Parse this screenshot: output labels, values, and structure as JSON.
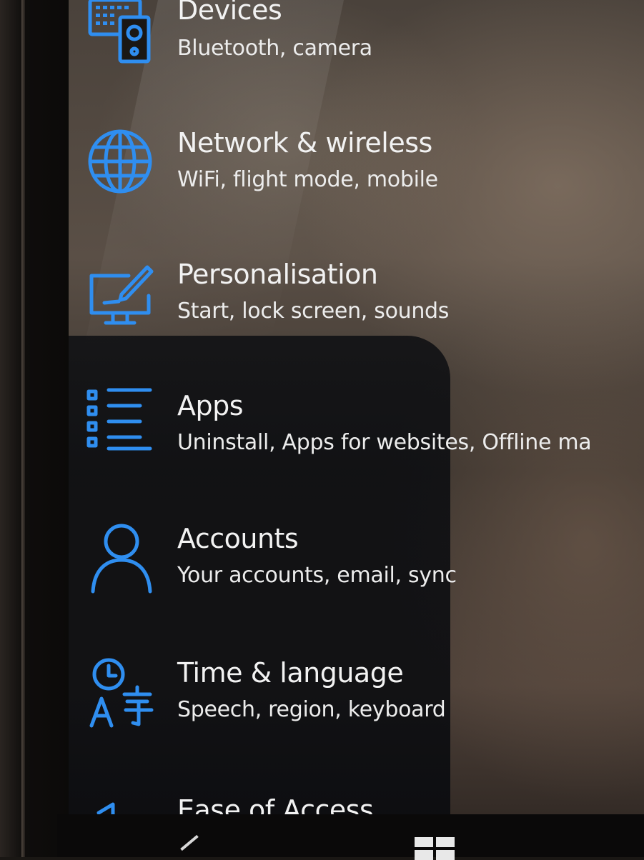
{
  "settings": {
    "items": [
      {
        "icon": "devices-icon",
        "title": "Devices",
        "subtitle": "Bluetooth, camera"
      },
      {
        "icon": "globe-icon",
        "title": "Network & wireless",
        "subtitle": "WiFi, flight mode, mobile"
      },
      {
        "icon": "personalisation-icon",
        "title": "Personalisation",
        "subtitle": "Start, lock screen, sounds"
      },
      {
        "icon": "apps-list-icon",
        "title": "Apps",
        "subtitle": "Uninstall, Apps for websites, Offline ma"
      },
      {
        "icon": "person-icon",
        "title": "Accounts",
        "subtitle": "Your accounts, email, sync"
      },
      {
        "icon": "time-language-icon",
        "title": "Time & language",
        "subtitle": "Speech, region, keyboard"
      },
      {
        "icon": "ease-of-access-icon",
        "title": "Ease of Access",
        "subtitle": ""
      }
    ]
  },
  "colors": {
    "accent": "#2f8ef0",
    "text": "#f2f2f2"
  },
  "nav_bar": {
    "back": "back-icon",
    "start": "windows-icon"
  }
}
